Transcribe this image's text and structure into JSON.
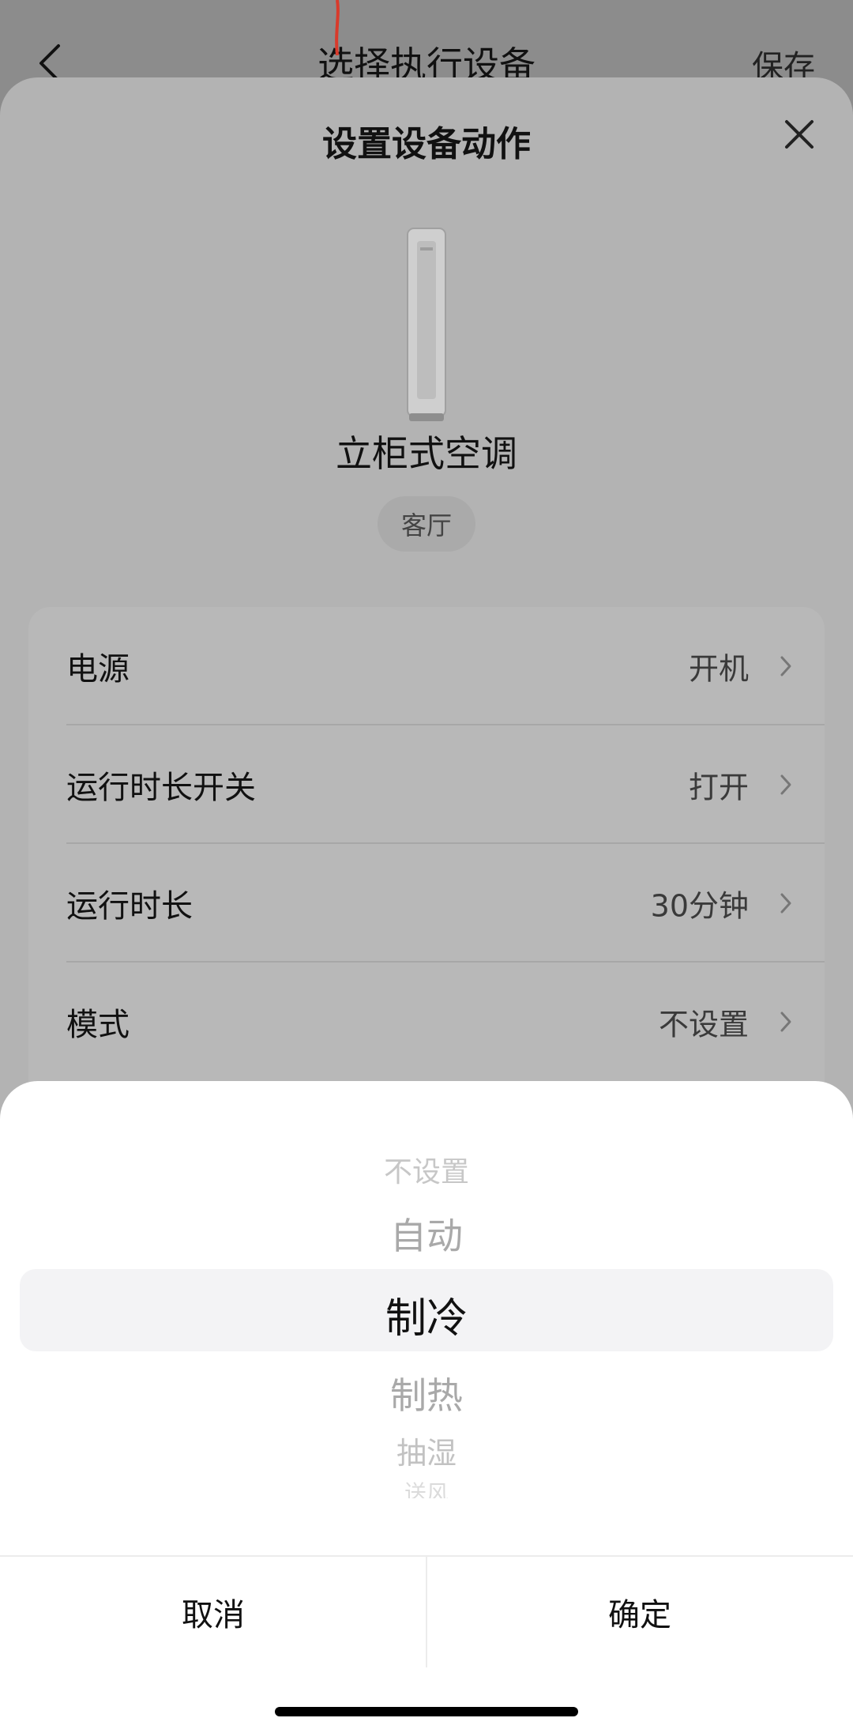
{
  "top_nav": {
    "title": "选择执行设备",
    "save_label": "保存",
    "icons": {
      "back": "chevron-left-icon"
    }
  },
  "sheet": {
    "title": "设置设备动作",
    "icons": {
      "close": "close-icon",
      "device": "tower-ac-icon"
    },
    "device": {
      "name": "立柜式空调",
      "room": "客厅"
    },
    "settings": [
      {
        "label": "电源",
        "value": "开机"
      },
      {
        "label": "运行时长开关",
        "value": "打开"
      },
      {
        "label": "运行时长",
        "value": "30分钟"
      },
      {
        "label": "模式",
        "value": "不设置"
      }
    ]
  },
  "picker": {
    "options": [
      "不设置",
      "自动",
      "制冷",
      "制热",
      "抽湿",
      "送风"
    ],
    "selected": "制冷",
    "cancel_label": "取消",
    "confirm_label": "确定"
  },
  "colors": {
    "accent_red": "#d93a2b",
    "dim_overlay": "#b3b3b3",
    "picker_bg": "#ffffff"
  }
}
